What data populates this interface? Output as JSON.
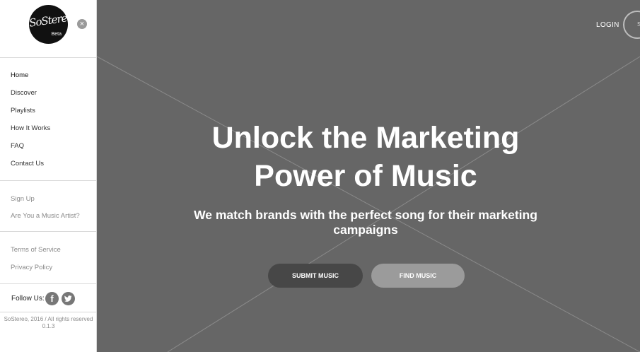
{
  "brand": {
    "logo_text": "SoStereo",
    "beta": "Beta"
  },
  "sidebar": {
    "close_symbol": "×",
    "primary_nav": [
      {
        "label": "Home"
      },
      {
        "label": "Discover"
      },
      {
        "label": "Playlists"
      },
      {
        "label": "How It Works"
      },
      {
        "label": "FAQ"
      },
      {
        "label": "Contact Us"
      }
    ],
    "account_nav": [
      {
        "label": "Sign Up"
      },
      {
        "label": "Are You a Music Artist?"
      }
    ],
    "legal_nav": [
      {
        "label": "Terms of Service"
      },
      {
        "label": "Privacy Policy"
      }
    ],
    "follow": {
      "label": "Follow Us:",
      "facebook_glyph": "f",
      "icons": [
        "facebook-icon",
        "twitter-icon"
      ]
    },
    "footer": {
      "copyright": "SoStereo, 2016 / All rights reserved",
      "version": "0.1.3"
    }
  },
  "header": {
    "login_label": "LOGIN",
    "signup_partial": "S"
  },
  "hero": {
    "title_line1": "Unlock the Marketing",
    "title_line2": "Power of Music",
    "subtitle_line1": "We match brands with the perfect song for their marketing",
    "subtitle_line2": "campaigns",
    "submit_label": "SUBMIT MUSIC",
    "find_label": "FIND MUSIC"
  },
  "colors": {
    "hero_bg": "#666666",
    "submit_bg": "#474747",
    "find_bg": "#9b9b9b",
    "sidebar_bg": "#ffffff"
  }
}
